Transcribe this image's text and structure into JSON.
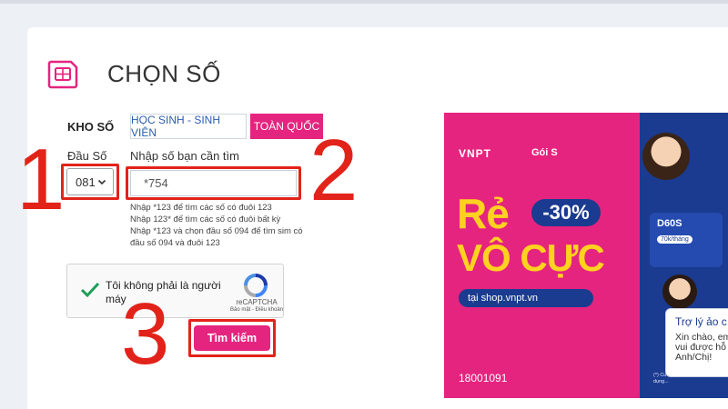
{
  "page": {
    "title": "CHỌN SỐ"
  },
  "kho_so": {
    "label": "KHO SỐ",
    "tabs": [
      {
        "label": "HỌC SINH - SINH VIÊN",
        "active": false
      },
      {
        "label": "TOÀN QUỐC",
        "active": true
      }
    ]
  },
  "dau_so": {
    "label": "Đầu Số",
    "selected": "081"
  },
  "so_input": {
    "label": "Nhập số bạn cần tìm",
    "value": "*754",
    "hints": [
      "Nhập *123 để tìm các số có đuôi 123",
      "Nhập 123* để tìm các số có đuôi bất kỳ",
      "Nhập *123 và chọn đầu số 094 để tìm sim có đầu số 094 và đuôi 123"
    ]
  },
  "captcha": {
    "text": "Tôi không phải là người máy",
    "brand": "reCAPTCHA",
    "links": "Bảo mật - Điều khoản"
  },
  "search_button": {
    "label": "Tìm kiếm"
  },
  "annotations": [
    "1",
    "2",
    "3"
  ],
  "banner": {
    "brand": "VNPT",
    "package": "Gói S",
    "headline_1": "Rẻ",
    "discount": "-30%",
    "headline_2": "VÔ CỰC",
    "shop": "tại  shop.vnpt.vn",
    "hotline": "18001091",
    "plan_name": "D60S",
    "plan_price": "70k/tháng",
    "notes": "(*) Cước gọi... (**) Giá áp dụng..."
  },
  "chat": {
    "title": "Trợ lý ảo c",
    "body": "Xin chào, em\nvui được hỗ\nAnh/Chị!"
  },
  "colors": {
    "accent": "#e5247f",
    "annotation_red": "#e2231a",
    "link_blue": "#2a5db0",
    "banner_blue": "#1a3b8f",
    "banner_yellow": "#ffd21f"
  }
}
